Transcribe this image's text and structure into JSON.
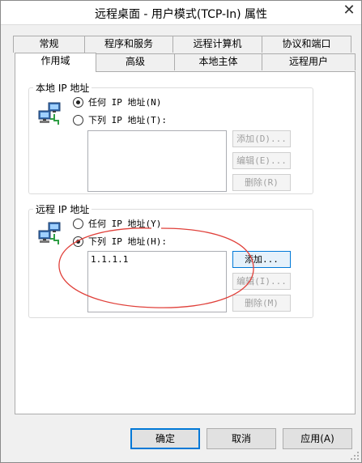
{
  "window": {
    "title": "远程桌面 - 用户模式(TCP-In) 属性",
    "close_glyph": "✕"
  },
  "tabs": {
    "row1": [
      {
        "label": "常规"
      },
      {
        "label": "程序和服务"
      },
      {
        "label": "远程计算机"
      },
      {
        "label": "协议和端口"
      }
    ],
    "row2": [
      {
        "label": "作用域",
        "active": true
      },
      {
        "label": "高级"
      },
      {
        "label": "本地主体"
      },
      {
        "label": "远程用户"
      }
    ]
  },
  "local_ip": {
    "title": "本地 IP 地址",
    "icon": "network-computers-icon",
    "option_any": "任何 IP 地址(N)",
    "option_list": "下列 IP 地址(T):",
    "selected": "any",
    "list_items": [],
    "buttons": {
      "add": "添加(D)...",
      "edit": "编辑(E)...",
      "remove": "删除(R)"
    }
  },
  "remote_ip": {
    "title": "远程 IP 地址",
    "icon": "network-computers-icon",
    "option_any": "任何 IP 地址(Y)",
    "option_list": "下列 IP 地址(H):",
    "selected": "list",
    "list_items": [
      "1.1.1.1"
    ],
    "buttons": {
      "add": "添加...",
      "edit": "编辑(I)...",
      "remove": "删除(M)"
    },
    "annotation_color": "#e0403a"
  },
  "footer": {
    "ok": "确定",
    "cancel": "取消",
    "apply": "应用(A)"
  },
  "colors": {
    "accent": "#0078d7",
    "annotation": "#e0403a"
  }
}
